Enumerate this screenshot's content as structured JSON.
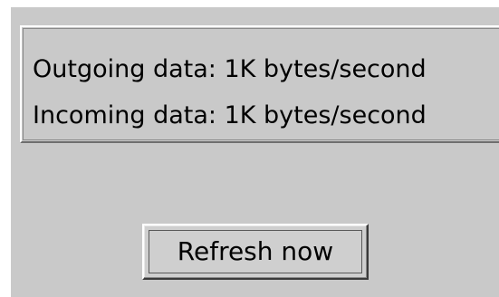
{
  "stats": {
    "outgoing": "Outgoing data: 1K bytes/second",
    "incoming": "Incoming data: 1K bytes/second"
  },
  "actions": {
    "refresh_label": "Refresh now"
  },
  "colors": {
    "window_background": "#c9c9c9",
    "text": "#000000"
  }
}
